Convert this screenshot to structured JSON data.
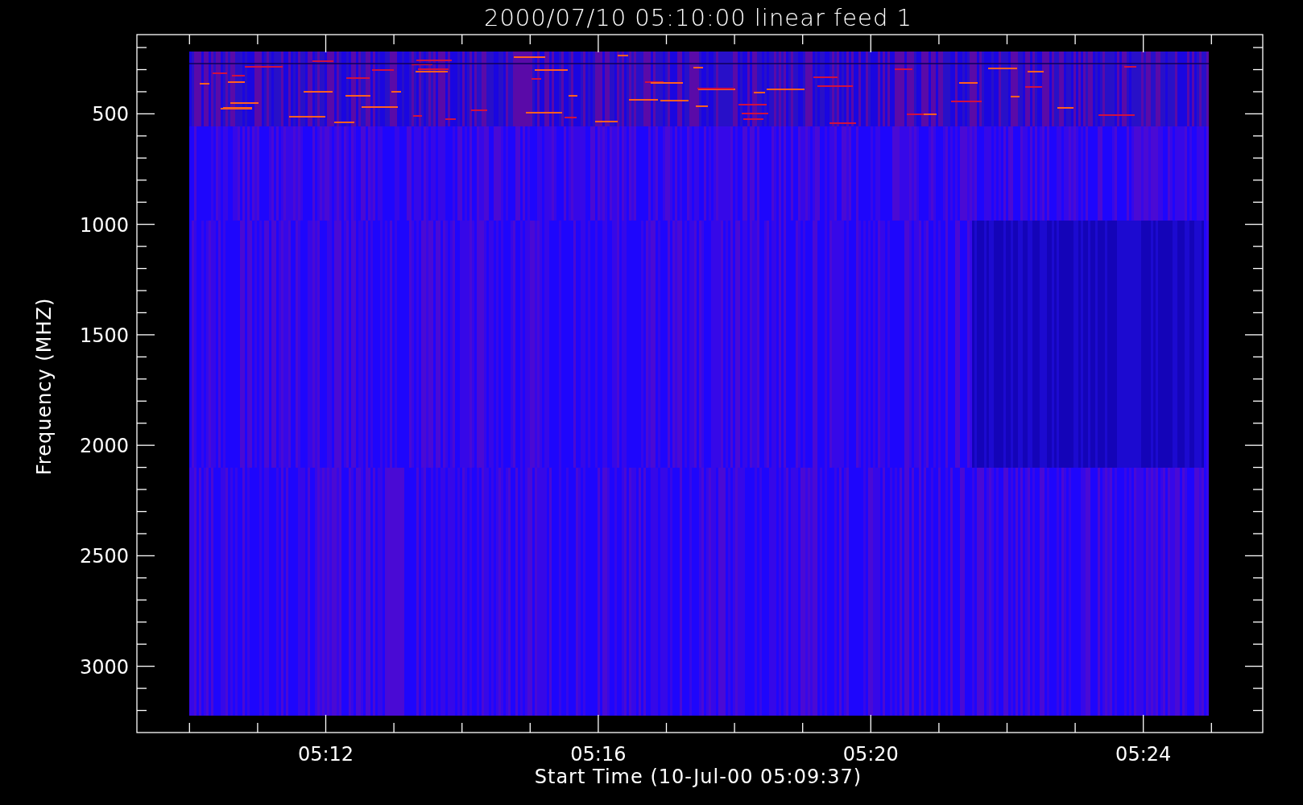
{
  "title": "2000/07/10 05:10:00 linear feed 1",
  "y_axis": {
    "label": "Frequency (MHZ)",
    "ticks": [
      "500",
      "1000",
      "1500",
      "2000",
      "2500",
      "3000"
    ]
  },
  "x_axis": {
    "label": "Start Time (10-Jul-00 05:09:37)",
    "ticks": [
      "05:12",
      "05:16",
      "05:20",
      "05:24"
    ]
  }
}
